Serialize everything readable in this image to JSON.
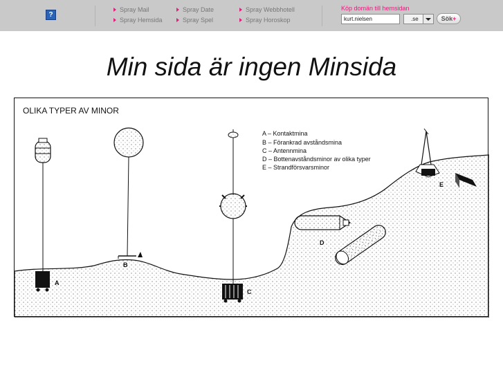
{
  "topbar": {
    "help_icon": "question-mark-icon",
    "help_label": "?",
    "nav_links": [
      {
        "label": "Spray Mail"
      },
      {
        "label": "Spray Date"
      },
      {
        "label": "Spray Webbhotell"
      },
      {
        "label": "Spray Hemsida"
      },
      {
        "label": "Spray Spel"
      },
      {
        "label": "Spray Horoskop"
      }
    ],
    "link_arrow_color": "#e0207a",
    "domain": {
      "title": "Köp domän till hemsidan",
      "input_value": "kurt.nielsen",
      "tld_value": ".se",
      "search_label": "Sök",
      "search_plus": "+"
    }
  },
  "page_title": "Min sida är ingen Minsida",
  "figure": {
    "heading": "OLIKA TYPER AV MINOR",
    "legend": [
      "A – Kontaktmina",
      "B – Förankrad avståndsmina",
      "C – Antennmina",
      "D – Bottenavståndsminor av olika typer",
      "E – Strandförsvarsminor"
    ],
    "labels": {
      "A": "A",
      "B": "B",
      "C": "C",
      "D": "D",
      "E": "E"
    }
  }
}
